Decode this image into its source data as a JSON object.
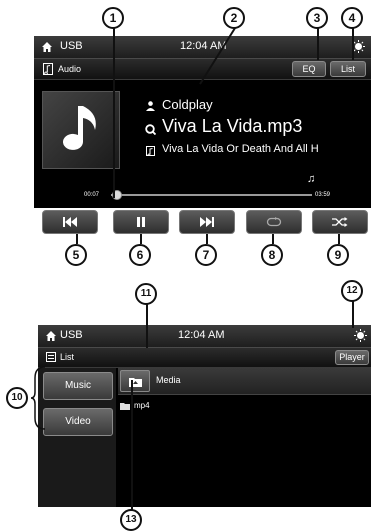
{
  "player": {
    "source": "USB",
    "time": "12:04 AM",
    "mode_label": "Audio",
    "eq_label": "EQ",
    "list_label": "List",
    "artist": "Coldplay",
    "filename": "Viva La Vida.mp3",
    "album": "Viva La Vida Or Death And All H",
    "elapsed": "00:07",
    "duration": "03:59",
    "progress": 0.03
  },
  "controls": [
    {
      "name": "previous",
      "icon": "skip-previous-icon"
    },
    {
      "name": "pause",
      "icon": "pause-icon"
    },
    {
      "name": "next",
      "icon": "skip-next-icon"
    },
    {
      "name": "repeat",
      "icon": "repeat-icon"
    },
    {
      "name": "shuffle",
      "icon": "shuffle-icon"
    }
  ],
  "list_screen": {
    "source": "USB",
    "time": "12:04 AM",
    "title": "List",
    "player_label": "Player",
    "categories": [
      "Music",
      "Video"
    ],
    "folder_label": "Media",
    "items": [
      "mp4"
    ]
  },
  "callouts": [
    "1",
    "2",
    "3",
    "4",
    "5",
    "6",
    "7",
    "8",
    "9",
    "10",
    "11",
    "12",
    "13"
  ],
  "colors": {
    "screen_bg": "#000000",
    "bar": "#2a2a2a",
    "button": "#4a4a4a",
    "text": "#ffffff",
    "callout": "#111111"
  }
}
